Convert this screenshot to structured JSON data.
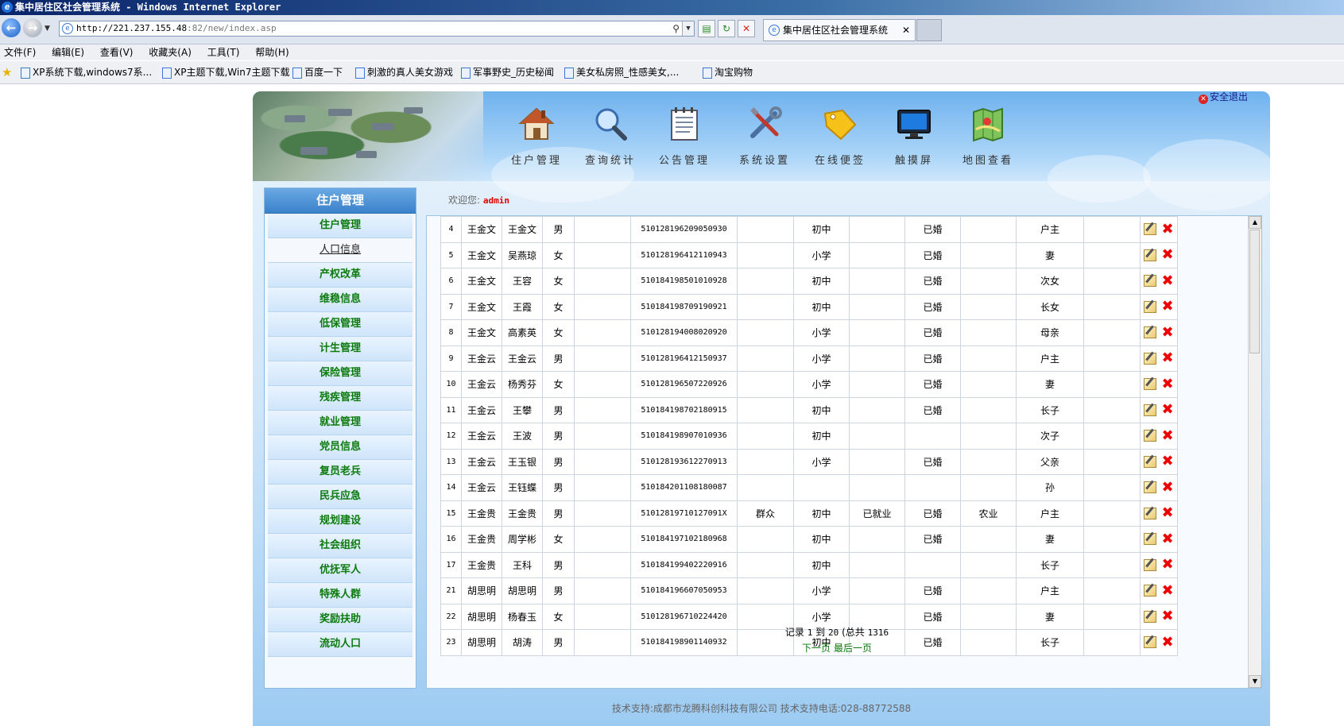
{
  "browser": {
    "window_title": "集中居住区社会管理系统 - Windows Internet Explorer",
    "url_host": "http://221.237.155.48",
    "url_path": ":82/new/index.asp",
    "tab_title": "集中居住区社会管理系统",
    "menu": [
      "文件(F)",
      "编辑(E)",
      "查看(V)",
      "收藏夹(A)",
      "工具(T)",
      "帮助(H)"
    ],
    "favorites": [
      "XP系统下载,windows7系...",
      "XP主题下载,Win7主题下载",
      "百度一下",
      "刺激的真人美女游戏",
      "军事野史_历史秘闻",
      "美女私房照_性感美女,...",
      "淘宝购物"
    ]
  },
  "header": {
    "logout_label": "安全退出",
    "nav": [
      {
        "label": "住户管理",
        "icon": "house-icon"
      },
      {
        "label": "查询统计",
        "icon": "magnifier-icon"
      },
      {
        "label": "公告管理",
        "icon": "notepad-icon"
      },
      {
        "label": "系统设置",
        "icon": "tools-icon"
      },
      {
        "label": "在线便签",
        "icon": "tag-icon"
      },
      {
        "label": "触摸屏",
        "icon": "monitor-icon"
      },
      {
        "label": "地图查看",
        "icon": "map-icon"
      }
    ]
  },
  "sidebar": {
    "title": "住户管理",
    "items": [
      "住户管理",
      "人口信息",
      "产权改革",
      "维稳信息",
      "低保管理",
      "计生管理",
      "保险管理",
      "残疾管理",
      "就业管理",
      "党员信息",
      "复员老兵",
      "民兵应急",
      "规划建设",
      "社会组织",
      "优抚军人",
      "特殊人群",
      "奖励扶助",
      "流动人口"
    ],
    "active_index": 1
  },
  "welcome": {
    "prefix": "欢迎您:",
    "user": "admin"
  },
  "table": {
    "rows": [
      [
        "4",
        "王金文",
        "王金文",
        "男",
        "",
        "510128196209050930",
        "",
        "初中",
        "",
        "已婚",
        "",
        "户主"
      ],
      [
        "5",
        "王金文",
        "吴燕琼",
        "女",
        "",
        "510128196412110943",
        "",
        "小学",
        "",
        "已婚",
        "",
        "妻"
      ],
      [
        "6",
        "王金文",
        "王容",
        "女",
        "",
        "510184198501010928",
        "",
        "初中",
        "",
        "已婚",
        "",
        "次女"
      ],
      [
        "7",
        "王金文",
        "王霞",
        "女",
        "",
        "510184198709190921",
        "",
        "初中",
        "",
        "已婚",
        "",
        "长女"
      ],
      [
        "8",
        "王金文",
        "高素英",
        "女",
        "",
        "510128194008020920",
        "",
        "小学",
        "",
        "已婚",
        "",
        "母亲"
      ],
      [
        "9",
        "王金云",
        "王金云",
        "男",
        "",
        "510128196412150937",
        "",
        "小学",
        "",
        "已婚",
        "",
        "户主"
      ],
      [
        "10",
        "王金云",
        "杨秀芬",
        "女",
        "",
        "510128196507220926",
        "",
        "小学",
        "",
        "已婚",
        "",
        "妻"
      ],
      [
        "11",
        "王金云",
        "王攀",
        "男",
        "",
        "510184198702180915",
        "",
        "初中",
        "",
        "已婚",
        "",
        "长子"
      ],
      [
        "12",
        "王金云",
        "王波",
        "男",
        "",
        "510184198907010936",
        "",
        "初中",
        "",
        "",
        "",
        "次子"
      ],
      [
        "13",
        "王金云",
        "王玉银",
        "男",
        "",
        "510128193612270913",
        "",
        "小学",
        "",
        "已婚",
        "",
        "父亲"
      ],
      [
        "14",
        "王金云",
        "王钰蝶",
        "男",
        "",
        "510184201108180087",
        "",
        "",
        "",
        "",
        "",
        "孙"
      ],
      [
        "15",
        "王金贵",
        "王金贵",
        "男",
        "",
        "51012819710127091X",
        "群众",
        "初中",
        "已就业",
        "已婚",
        "农业",
        "户主"
      ],
      [
        "16",
        "王金贵",
        "周学彬",
        "女",
        "",
        "510184197102180968",
        "",
        "初中",
        "",
        "已婚",
        "",
        "妻"
      ],
      [
        "17",
        "王金贵",
        "王科",
        "男",
        "",
        "510184199402220916",
        "",
        "初中",
        "",
        "",
        "",
        "长子"
      ],
      [
        "21",
        "胡思明",
        "胡思明",
        "男",
        "",
        "510184196607050953",
        "",
        "小学",
        "",
        "已婚",
        "",
        "户主"
      ],
      [
        "22",
        "胡思明",
        "杨春玉",
        "女",
        "",
        "510128196710224420",
        "",
        "小学",
        "",
        "已婚",
        "",
        "妻"
      ],
      [
        "23",
        "胡思明",
        "胡涛",
        "男",
        "",
        "510184198901140932",
        "",
        "初中",
        "",
        "已婚",
        "",
        "长子"
      ]
    ]
  },
  "pager": {
    "record_label": "记录",
    "from": "1",
    "to_label": "到",
    "to": "20",
    "total_label": "(总共",
    "total": "1316",
    "next_label": "下一页",
    "last_label": "最后一页"
  },
  "footer": {
    "text": "技术支持:成都市龙腾科创科技有限公司 技术支持电话:028-88772588"
  }
}
